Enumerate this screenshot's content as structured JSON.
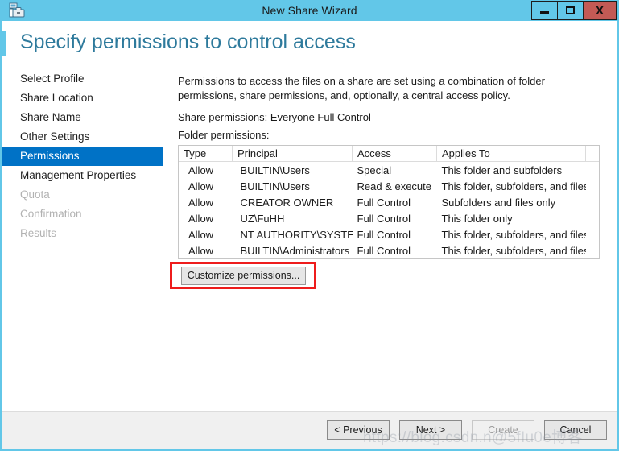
{
  "titlebar": {
    "title": "New Share Wizard",
    "icon": "server-manager-icon",
    "minimize_label": "–",
    "maximize_label": "❐",
    "close_label": "X"
  },
  "page": {
    "heading": "Specify permissions to control access"
  },
  "sidebar": {
    "items": [
      {
        "label": "Select Profile",
        "state": "normal"
      },
      {
        "label": "Share Location",
        "state": "normal"
      },
      {
        "label": "Share Name",
        "state": "normal"
      },
      {
        "label": "Other Settings",
        "state": "normal"
      },
      {
        "label": "Permissions",
        "state": "selected"
      },
      {
        "label": "Management Properties",
        "state": "normal"
      },
      {
        "label": "Quota",
        "state": "disabled"
      },
      {
        "label": "Confirmation",
        "state": "disabled"
      },
      {
        "label": "Results",
        "state": "disabled"
      }
    ]
  },
  "main": {
    "intro": "Permissions to access the files on a share are set using a combination of folder permissions, share permissions, and, optionally, a central access policy.",
    "share_permissions": "Share permissions: Everyone Full Control",
    "folder_permissions_label": "Folder permissions:",
    "table": {
      "columns": [
        "Type",
        "Principal",
        "Access",
        "Applies To",
        ""
      ],
      "rows": [
        [
          "Allow",
          "BUILTIN\\Users",
          "Special",
          "This folder and subfolders",
          ""
        ],
        [
          "Allow",
          "BUILTIN\\Users",
          "Read & execute",
          "This folder, subfolders, and files",
          ""
        ],
        [
          "Allow",
          "CREATOR OWNER",
          "Full Control",
          "Subfolders and files only",
          ""
        ],
        [
          "Allow",
          "UZ\\FuHH",
          "Full Control",
          "This folder only",
          ""
        ],
        [
          "Allow",
          "NT AUTHORITY\\SYSTEM",
          "Full Control",
          "This folder, subfolders, and files",
          ""
        ],
        [
          "Allow",
          "BUILTIN\\Administrators",
          "Full Control",
          "This folder, subfolders, and files",
          ""
        ]
      ]
    },
    "customize_button": "Customize permissions...",
    "annotation_color": "#ee1c1c"
  },
  "footer": {
    "previous": "< Previous",
    "next": "Next >",
    "create": "Create",
    "cancel": "Cancel"
  },
  "watermark": {
    "text": "https://blog.csdn.n@5fIu0e博客"
  },
  "colors": {
    "titlebar": "#62c7e8",
    "accent_blue": "#0072c6",
    "heading": "#2e7a9c",
    "close_button": "#c35a55",
    "footer_bg": "#f0f0f0"
  }
}
